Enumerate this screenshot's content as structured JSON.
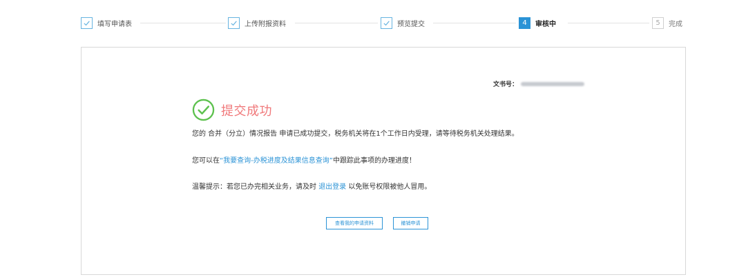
{
  "stepper": {
    "steps": [
      {
        "index": "1",
        "label": "填写申请表",
        "state": "done"
      },
      {
        "index": "2",
        "label": "上传附报资料",
        "state": "done"
      },
      {
        "index": "3",
        "label": "预览提交",
        "state": "done"
      },
      {
        "index": "4",
        "label": "审核中",
        "state": "active"
      },
      {
        "index": "5",
        "label": "完成",
        "state": "pending"
      }
    ]
  },
  "panel": {
    "doc_no_label": "文书号：",
    "success_title": "提交成功",
    "message_line1": "您的 合并（分立）情况报告 申请已成功提交，税务机关将在1个工作日内受理，请等待税务机关处理结果。",
    "message_line2_prefix": "您可以在",
    "message_line2_link": "“我要查询-办税进度及结果信息查询”",
    "message_line2_suffix": "中跟踪此事项的办理进度！",
    "message_line3_prefix": "温馨提示：若您已办完相关业务，请及时 ",
    "message_line3_link": "退出登录",
    "message_line3_suffix": " 以免账号权限被他人冒用。",
    "view_button": "查看我的申请资料",
    "cancel_button": "撤销申请"
  },
  "colors": {
    "accent": "#2b93d6",
    "success_green": "#5dc14e",
    "success_text": "#f0787a",
    "border": "#d8d8d8"
  },
  "icons": {
    "done_step": "check-icon",
    "success": "check-circle-icon"
  }
}
